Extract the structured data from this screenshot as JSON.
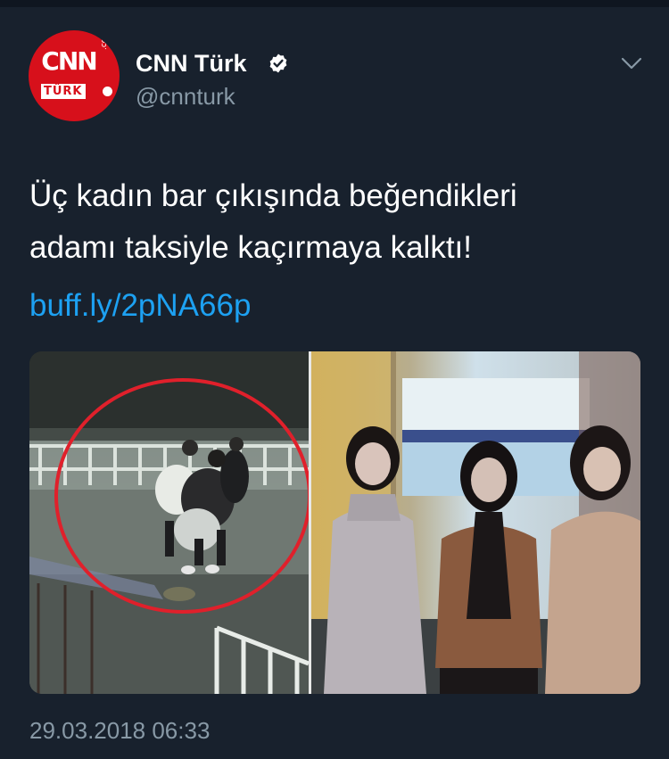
{
  "tweet": {
    "author": {
      "name": "CNN Türk",
      "handle": "@cnnturk",
      "verified": true,
      "avatar": {
        "logo_text": "CNN",
        "logo_sub": "TÜRK",
        "logo_com": ".com",
        "brand_color": "#d7101b"
      }
    },
    "text_line1": "Üç kadın bar çıkışında beğendikleri",
    "text_line2": "adamı taksiyle kaçırmaya kalktı!",
    "link": "buff.ly/2pNA66p",
    "timestamp": "29.03.2018 06:33",
    "menu_icon": "chevron-down-icon",
    "colors": {
      "background": "#18212d",
      "link": "#1da1f2",
      "secondary_text": "#8899a6"
    }
  }
}
